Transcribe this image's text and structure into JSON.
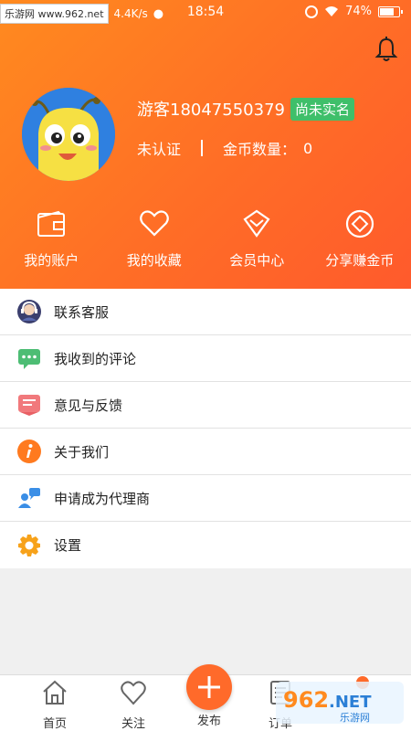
{
  "status_bar": {
    "site_watermark": "乐游网 www.962.net",
    "net_speed": "4.4K/s",
    "time": "18:54",
    "battery_percent": "74%",
    "battery_level": 0.74
  },
  "profile": {
    "username": "游客18047550379",
    "verify_badge": "尚未实名",
    "certification": "未认证",
    "coin_label": "金币数量：",
    "coin_value": "0"
  },
  "quick_actions": [
    {
      "label": "我的账户",
      "icon": "wallet-icon"
    },
    {
      "label": "我的收藏",
      "icon": "heart-icon"
    },
    {
      "label": "会员中心",
      "icon": "diamond-icon"
    },
    {
      "label": "分享赚金币",
      "icon": "share-coin-icon"
    }
  ],
  "menu": [
    {
      "label": "联系客服",
      "icon": "customer-service-icon"
    },
    {
      "label": "我收到的评论",
      "icon": "comment-icon"
    },
    {
      "label": "意见与反馈",
      "icon": "feedback-icon"
    },
    {
      "label": "关于我们",
      "icon": "about-icon"
    },
    {
      "label": "申请成为代理商",
      "icon": "agent-icon"
    },
    {
      "label": "设置",
      "icon": "settings-icon"
    }
  ],
  "tabbar": {
    "home": "首页",
    "follow": "关注",
    "publish": "发布",
    "orders": "订单"
  },
  "watermark_br": "962.NET 乐游网",
  "colors": {
    "accent": "#ff6a2a",
    "header_start": "#ff8a1f",
    "header_end": "#ff5a2c",
    "badge_green": "#3fbf6a"
  }
}
